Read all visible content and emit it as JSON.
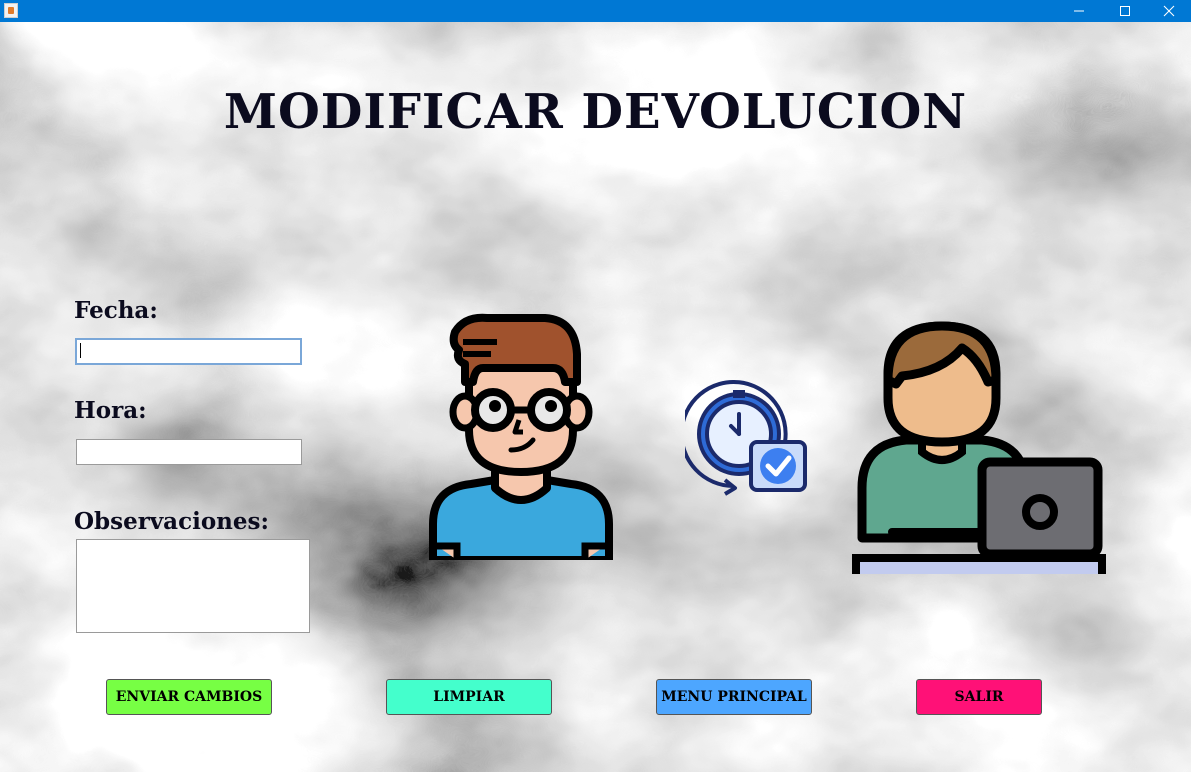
{
  "window": {
    "title": "",
    "controls": [
      "minimize-icon",
      "maximize-icon",
      "close-icon"
    ]
  },
  "page": {
    "title": "MODIFICAR DEVOLUCION"
  },
  "form": {
    "fecha": {
      "label": "Fecha:",
      "value": "",
      "placeholder": ""
    },
    "hora": {
      "label": "Hora:",
      "value": "",
      "placeholder": ""
    },
    "observaciones": {
      "label": "Observaciones:",
      "value": "",
      "placeholder": ""
    }
  },
  "buttons": {
    "enviar": {
      "label": "ENVIAR CAMBIOS",
      "color": "#77ff44"
    },
    "limpiar": {
      "label": "LIMPIAR",
      "color": "#44ffcc"
    },
    "menu": {
      "label": "MENU PRINCIPAL",
      "color": "#4da6ff"
    },
    "salir": {
      "label": "SALIR",
      "color": "#ff1177"
    }
  },
  "illustrations": [
    "student-avatar-icon",
    "clock-check-icon",
    "person-laptop-icon"
  ],
  "colors": {
    "titlebar": "#0078d4",
    "title_text": "#0b0b1e"
  }
}
